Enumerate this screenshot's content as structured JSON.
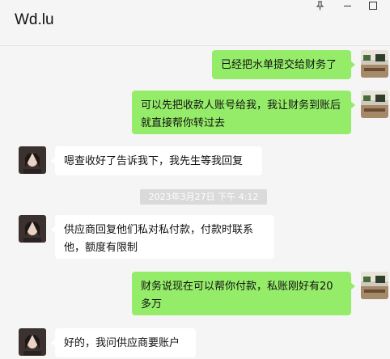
{
  "window": {
    "title": "Wd.lu",
    "pin_icon": "pin-icon",
    "minimize_icon": "minimize-icon",
    "maximize_icon": "maximize-icon"
  },
  "messages": [
    {
      "side": "out",
      "text": "已经把水单提交给财务了"
    },
    {
      "side": "out",
      "text": "可以先把收款人账号给我，我让财务到账后就直接帮你转过去"
    },
    {
      "side": "in",
      "text": "嗯查收好了告诉我下，我先生等我回复"
    },
    {
      "side": "in",
      "text": "供应商回复他们私对私付款，付款时联系他，额度有限制"
    },
    {
      "side": "out",
      "text": "财务说现在可以帮你付款，私账刚好有20多万"
    },
    {
      "side": "in",
      "text": "好的，我问供应商要账户"
    }
  ],
  "timestamp": "2023年3月27日 下午 4:12",
  "colors": {
    "outgoing_bubble": "#95ec69",
    "incoming_bubble": "#ffffff",
    "background": "#f5f5f5",
    "timestamp_bg": "#dadada"
  }
}
